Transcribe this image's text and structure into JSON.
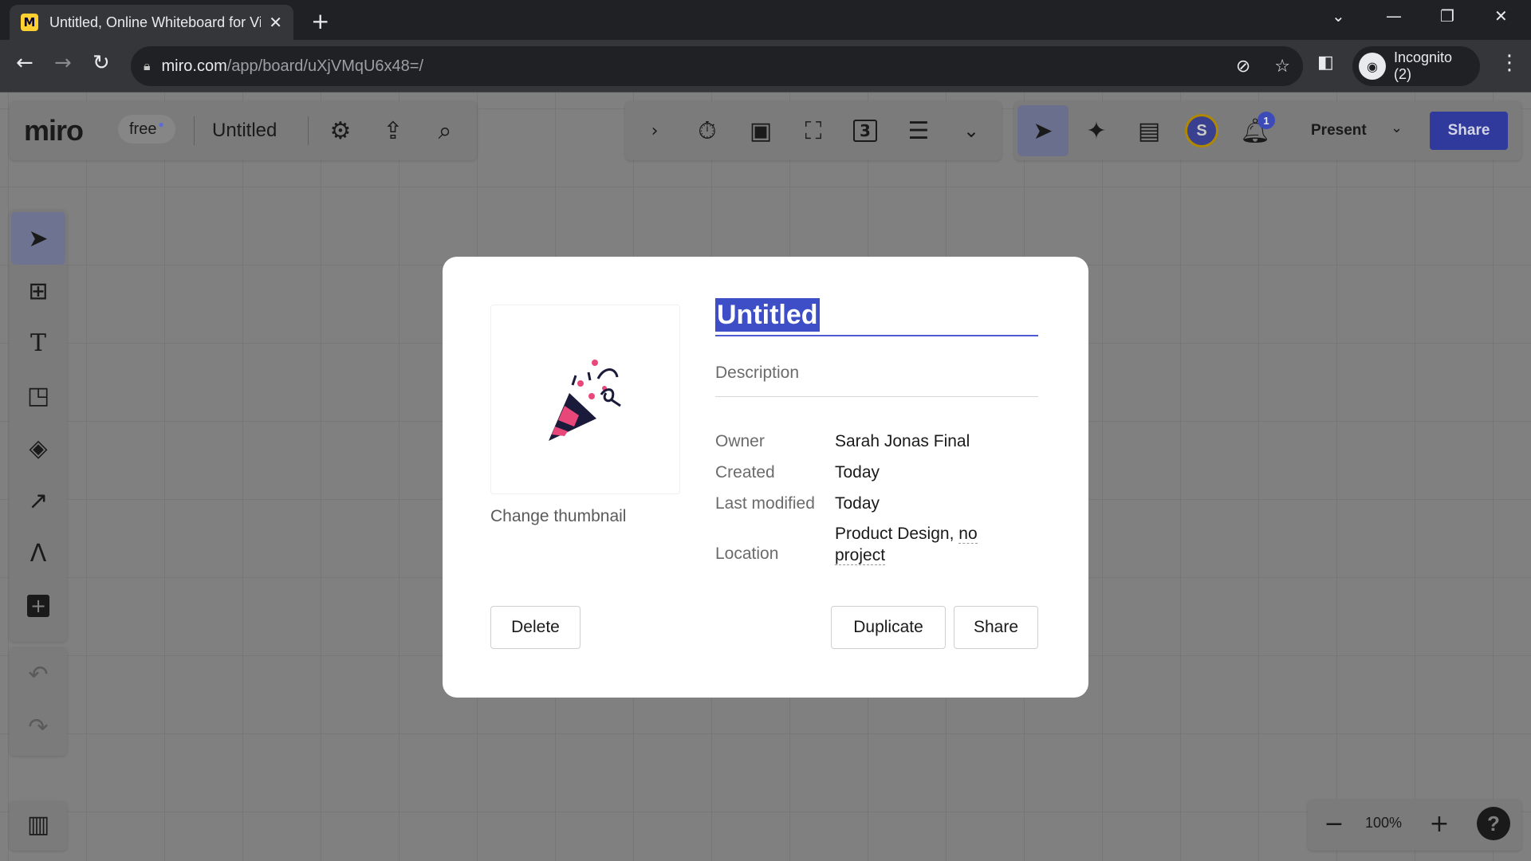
{
  "browser": {
    "tab_title": "Untitled, Online Whiteboard for Visual Collaboration",
    "favicon_letter": "M",
    "url_host": "miro.com",
    "url_path": "/app/board/uXjVMqU6x48=/",
    "profile_label": "Incognito (2)"
  },
  "toolbar": {
    "logo": "miro",
    "plan_badge": "free",
    "board_title": "Untitled",
    "present_label": "Present",
    "share_label": "Share",
    "avatar_initial": "S",
    "notification_count": "1",
    "board_counter": "3"
  },
  "zoom": {
    "value": "100%",
    "help": "?"
  },
  "modal": {
    "title": "Untitled",
    "description_placeholder": "Description",
    "change_thumbnail": "Change thumbnail",
    "owner_label": "Owner",
    "owner_value": "Sarah Jonas Final",
    "created_label": "Created",
    "created_value": "Today",
    "modified_label": "Last modified",
    "modified_value": "Today",
    "location_label": "Location",
    "location_team": "Product Design,",
    "location_project": "no project",
    "delete_label": "Delete",
    "duplicate_label": "Duplicate",
    "share_label": "Share"
  },
  "colors": {
    "accent": "#4262ff",
    "share_button": "#2f3a9c",
    "selection": "#3d4ec7"
  }
}
